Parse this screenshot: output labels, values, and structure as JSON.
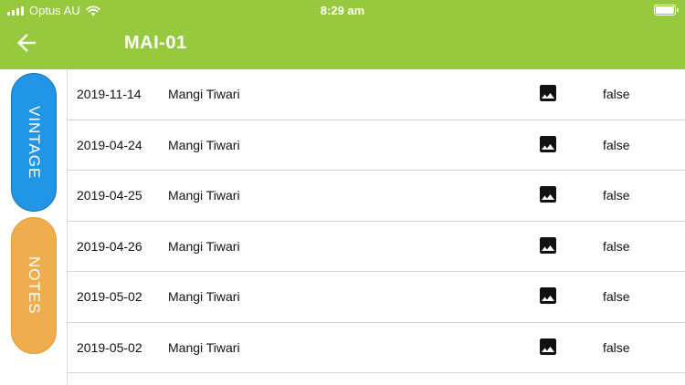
{
  "status_bar": {
    "carrier": "Optus AU",
    "time": "8:29 am",
    "icons": [
      "signal-icon",
      "wifi-icon",
      "battery-icon"
    ]
  },
  "header": {
    "title": "MAI-01",
    "back_icon": "arrow-left-icon",
    "background_color": "#96c93d"
  },
  "side_tabs": [
    {
      "label": "VINTAGE",
      "color": "#2196e6"
    },
    {
      "label": "NOTES",
      "color": "#f0ad4e"
    }
  ],
  "rows": [
    {
      "date": "2019-11-14",
      "name": "Mangi Tiwari",
      "icon": "image-icon",
      "flag": "false"
    },
    {
      "date": "2019-04-24",
      "name": "Mangi Tiwari",
      "icon": "image-icon",
      "flag": "false"
    },
    {
      "date": "2019-04-25",
      "name": "Mangi Tiwari",
      "icon": "image-icon",
      "flag": "false"
    },
    {
      "date": "2019-04-26",
      "name": "Mangi Tiwari",
      "icon": "image-icon",
      "flag": "false"
    },
    {
      "date": "2019-05-02",
      "name": "Mangi Tiwari",
      "icon": "image-icon",
      "flag": "false"
    },
    {
      "date": "2019-05-02",
      "name": "Mangi Tiwari",
      "icon": "image-icon",
      "flag": "false"
    }
  ]
}
